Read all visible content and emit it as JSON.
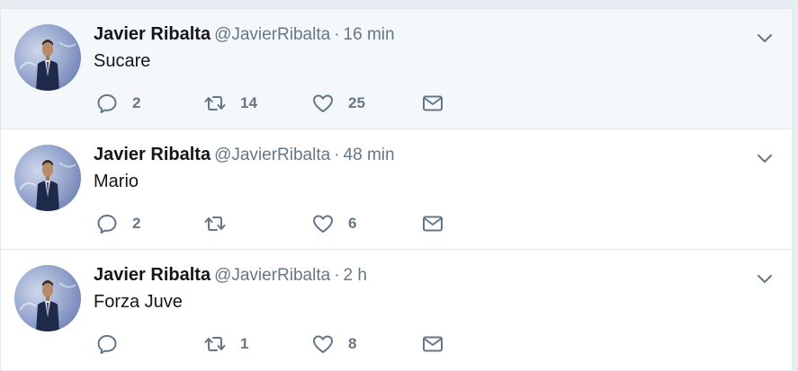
{
  "tweets": [
    {
      "author": {
        "fullname": "Javier Ribalta",
        "username": "@JavierRibalta"
      },
      "separator": "·",
      "time": "16 min",
      "text": "Sucare",
      "counts": {
        "reply": "2",
        "retweet": "14",
        "like": "25"
      },
      "highlighted": true
    },
    {
      "author": {
        "fullname": "Javier Ribalta",
        "username": "@JavierRibalta"
      },
      "separator": "·",
      "time": "48 min",
      "text": "Mario",
      "counts": {
        "reply": "2",
        "retweet": "",
        "like": "6"
      },
      "highlighted": false
    },
    {
      "author": {
        "fullname": "Javier Ribalta",
        "username": "@JavierRibalta"
      },
      "separator": "·",
      "time": "2 h",
      "text": "Forza Juve",
      "counts": {
        "reply": "",
        "retweet": "1",
        "like": "8"
      },
      "highlighted": false
    }
  ],
  "icons": {
    "reply": "reply-icon",
    "retweet": "retweet-icon",
    "like": "heart-icon",
    "dm": "envelope-icon",
    "caret": "chevron-down-icon"
  },
  "colors": {
    "text_primary": "#14171a",
    "text_secondary": "#657786",
    "border": "#e1e8ed",
    "hover_bg": "#f5f8fa"
  }
}
